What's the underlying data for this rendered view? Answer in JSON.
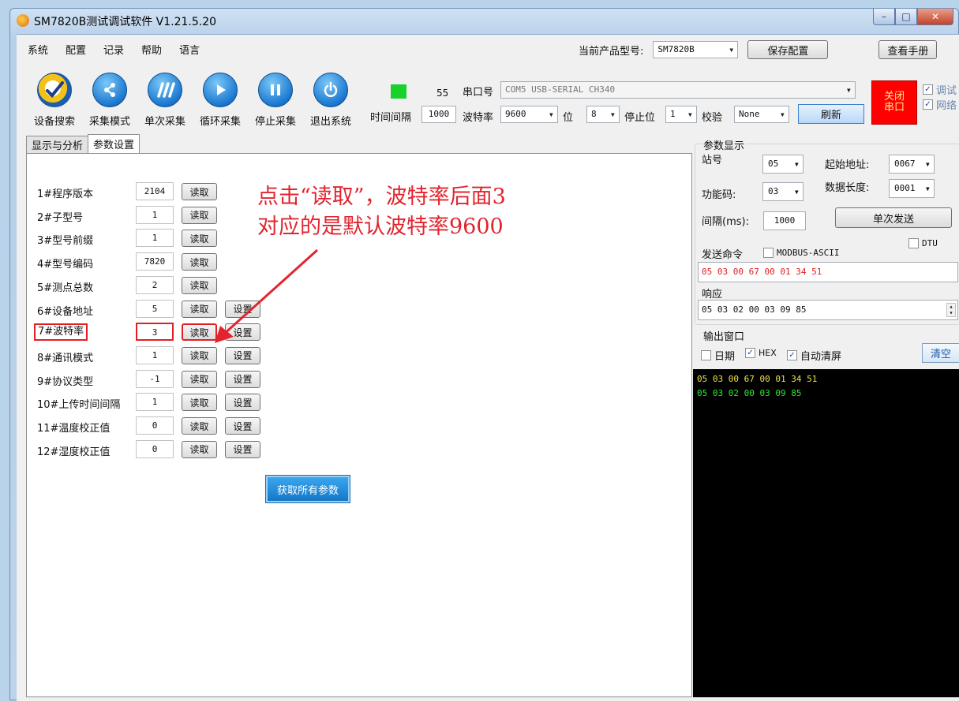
{
  "window": {
    "title": "SM7820B测试调试软件   V1.21.5.20",
    "controls": {
      "minimize": "–",
      "maximize": "□",
      "close": "✕"
    }
  },
  "menu": [
    "系统",
    "配置",
    "记录",
    "帮助",
    "语言"
  ],
  "product": {
    "label": "当前产品型号:",
    "value": "SM7820B",
    "save_button": "保存配置",
    "manual_button": "查看手册"
  },
  "toolbar": [
    {
      "label": "设备搜索",
      "icon": "device-search-icon"
    },
    {
      "label": "采集模式",
      "icon": "share-icon"
    },
    {
      "label": "单次采集",
      "icon": "single-collect-icon"
    },
    {
      "label": "循环采集",
      "icon": "play-icon"
    },
    {
      "label": "停止采集",
      "icon": "pause-icon"
    },
    {
      "label": "退出系统",
      "icon": "power-icon"
    }
  ],
  "status": {
    "indicator_color": "#18d22c",
    "counter": "55",
    "interval_label": "时间间隔",
    "interval_value": "1000"
  },
  "serial": {
    "port_label": "串口号",
    "port_value": "COM5 USB-SERIAL CH340",
    "baud_label": "波特率",
    "baud_value": "9600",
    "bits_label": "位",
    "bits_value": "8",
    "stop_label": "停止位",
    "stop_value": "1",
    "parity_label": "校验",
    "parity_value": "None",
    "refresh_button": "刷新",
    "close_port_button": "关闭串口"
  },
  "options": {
    "debug_label": "调试",
    "network_label": "网络"
  },
  "tabs": [
    {
      "label": "显示与分析",
      "active": false
    },
    {
      "label": "参数设置",
      "active": true
    }
  ],
  "read_label": "读取",
  "set_label": "设置",
  "params": [
    {
      "label": "1#程序版本",
      "value": "2104",
      "settable": false
    },
    {
      "label": "2#子型号",
      "value": "1",
      "settable": false
    },
    {
      "label": "3#型号前缀",
      "value": "1",
      "settable": false
    },
    {
      "label": "4#型号编码",
      "value": "7820",
      "settable": false
    },
    {
      "label": "5#测点总数",
      "value": "2",
      "settable": false
    },
    {
      "label": "6#设备地址",
      "value": "5",
      "settable": true
    },
    {
      "label": "7#波特率",
      "value": "3",
      "settable": true,
      "highlight": true
    },
    {
      "label": "8#通讯模式",
      "value": "1",
      "settable": true
    },
    {
      "label": "9#协议类型",
      "value": "-1",
      "settable": true
    },
    {
      "label": "10#上传时间间隔",
      "value": "1",
      "settable": true
    },
    {
      "label": "11#温度校正值",
      "value": "0",
      "settable": true
    },
    {
      "label": "12#湿度校正值",
      "value": "0",
      "settable": true
    }
  ],
  "get_all_button": "获取所有参数",
  "annotation": {
    "line1": "点击“读取”，波特率后面3",
    "line2": "对应的是默认波特率9600",
    "color": "#e2242e"
  },
  "param_display": {
    "title": "参数显示",
    "station_label": "站号",
    "station_value": "05",
    "start_addr_label": "起始地址:",
    "start_addr_value": "0067",
    "func_label": "功能码:",
    "func_value": "03",
    "data_len_label": "数据长度:",
    "data_len_value": "0001",
    "interval_label": "间隔(ms):",
    "interval_value": "1000",
    "send_once_button": "单次发送",
    "dtu_label": "DTU",
    "send_cmd_label": "发送命令",
    "modbus_ascii_label": "MODBUS-ASCII",
    "send_cmd_value": "05 03 00 67 00 01 34 51",
    "send_cmd_color": "#e02020",
    "response_label": "响应",
    "response_value": "05 03 02 00 03 09 85"
  },
  "output": {
    "title": "输出窗口",
    "date_label": "日期",
    "hex_label": "HEX",
    "auto_clear_label": "自动清屏",
    "clear_button": "清空",
    "lines": [
      {
        "text": "05 03 00 67 00 01 34 51",
        "color": "#f0e040"
      },
      {
        "text": "05 03 02 00 03 09 85",
        "color": "#2ee82e"
      }
    ]
  }
}
